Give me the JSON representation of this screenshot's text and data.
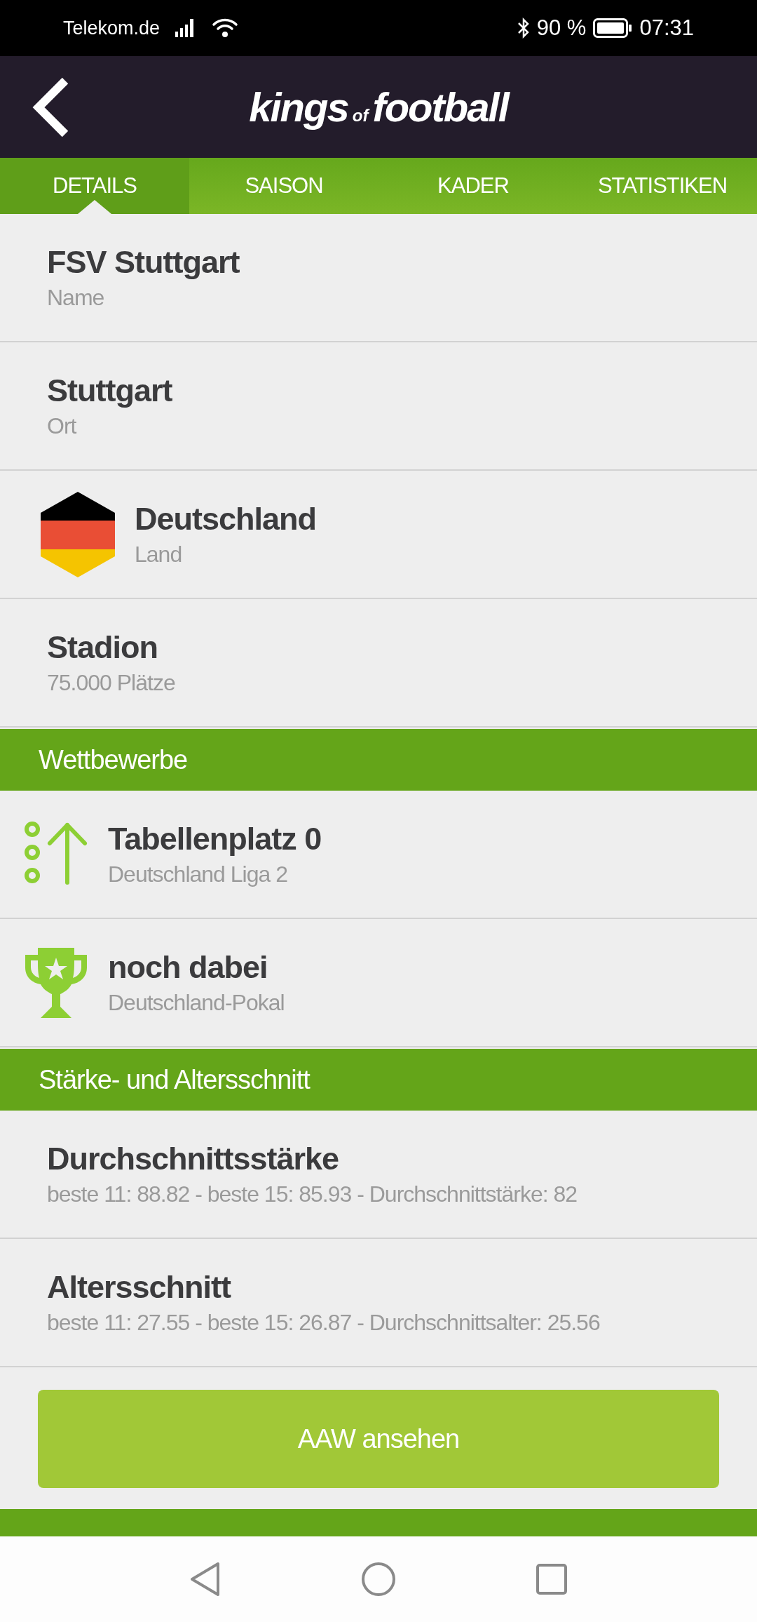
{
  "status_bar": {
    "carrier": "Telekom.de",
    "battery": "90 %",
    "time": "07:31"
  },
  "header": {
    "logo_main": "kings",
    "logo_small": "of",
    "logo_end": "football"
  },
  "tabs": [
    {
      "label": "DETAILS",
      "selected": true
    },
    {
      "label": "SAISON",
      "selected": false
    },
    {
      "label": "KADER",
      "selected": false
    },
    {
      "label": "STATISTIKEN",
      "selected": false
    }
  ],
  "details": [
    {
      "kind": "plain",
      "title": "FSV Stuttgart",
      "subtitle": "Name"
    },
    {
      "kind": "plain",
      "title": "Stuttgart",
      "subtitle": "Ort"
    },
    {
      "kind": "flag",
      "title": "Deutschland",
      "subtitle": "Land"
    },
    {
      "kind": "plain",
      "title": "Stadion",
      "subtitle": "75.000 Plätze"
    }
  ],
  "sections": [
    {
      "title": "Wettbewerbe",
      "rows": [
        {
          "kind": "rank",
          "title": "Tabellenplatz 0",
          "subtitle": "Deutschland Liga 2"
        },
        {
          "kind": "trophy",
          "title": "noch dabei",
          "subtitle": "Deutschland-Pokal"
        }
      ]
    },
    {
      "title": "Stärke- und Altersschnitt",
      "rows": [
        {
          "kind": "plain",
          "title": "Durchschnittsstärke",
          "subtitle": "beste 11: 88.82 - beste 15: 85.93 - Durchschnittstärke: 82"
        },
        {
          "kind": "plain",
          "title": "Altersschnitt",
          "subtitle": "beste 11: 27.55 - beste 15: 26.87 - Durchschnittsalter: 25.56"
        }
      ],
      "button": "AAW ansehen"
    }
  ]
}
